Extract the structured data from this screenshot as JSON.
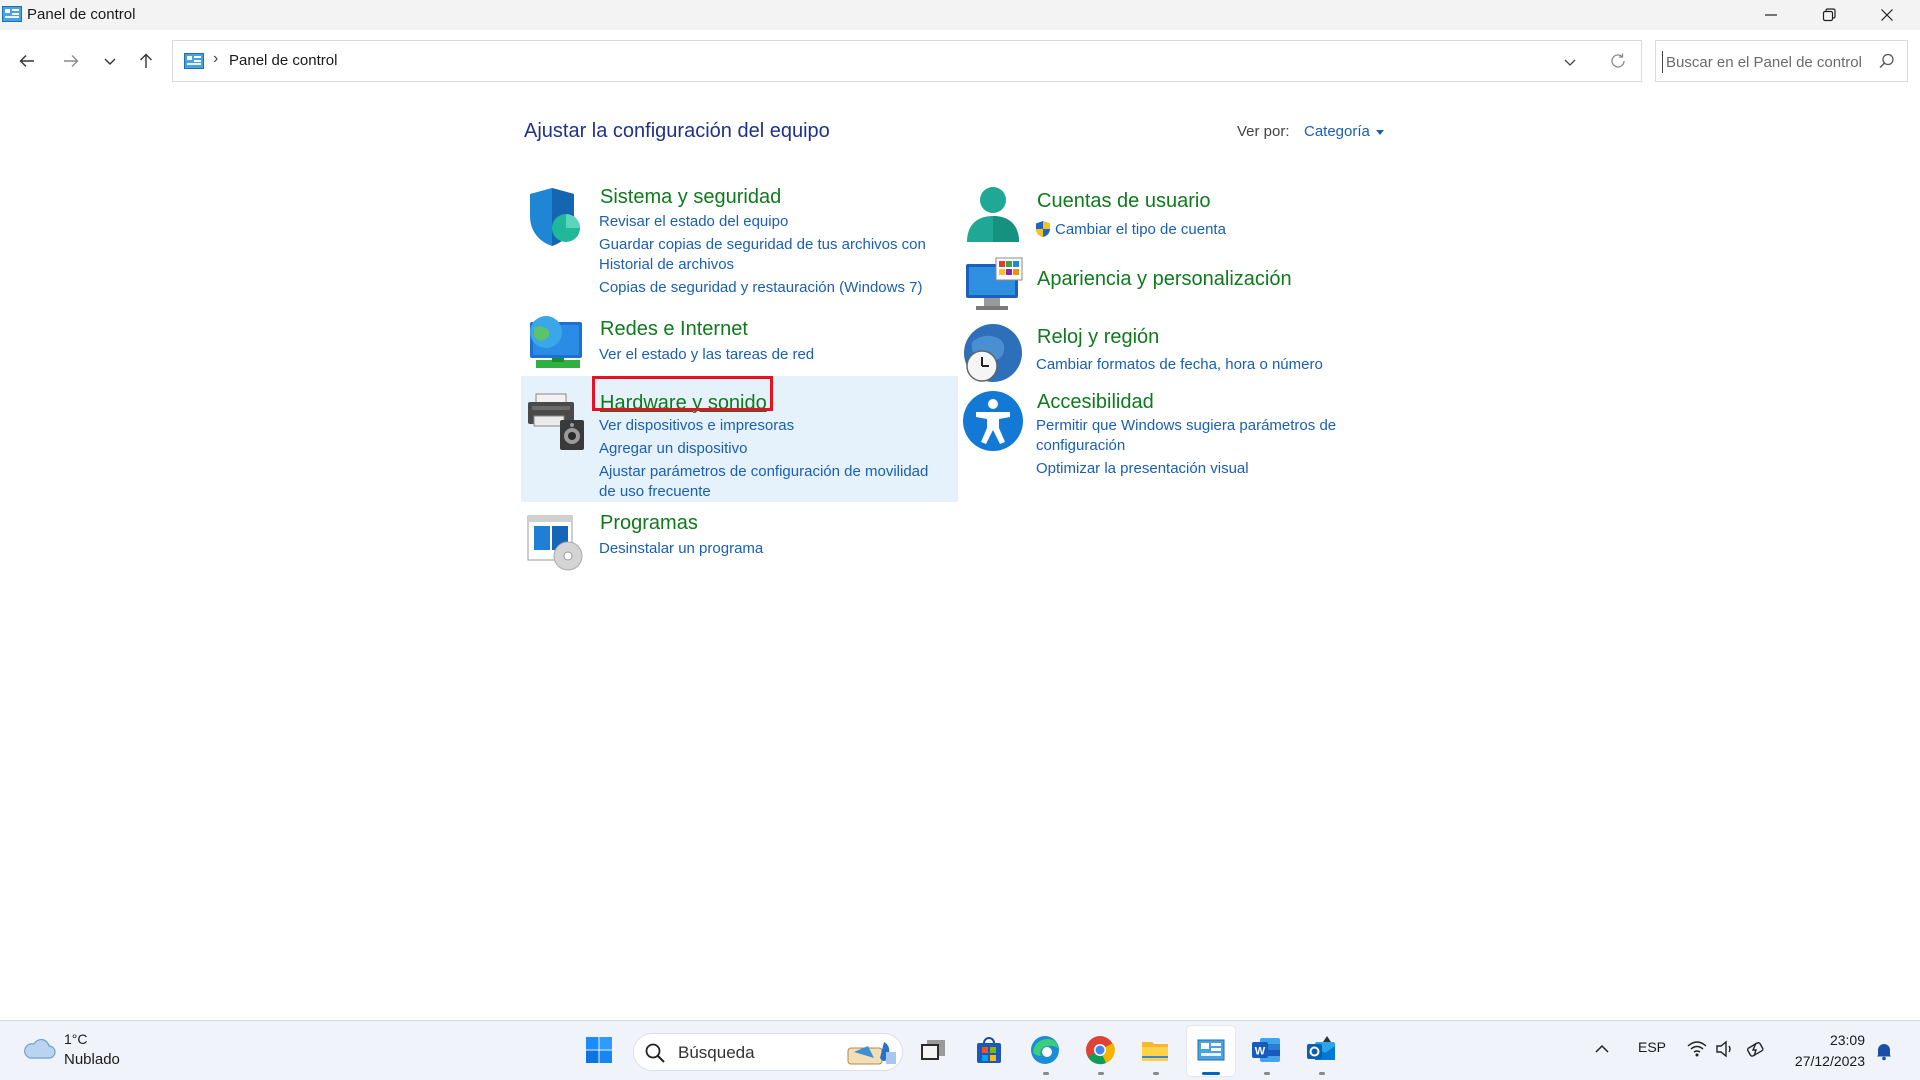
{
  "window": {
    "title": "Panel de control",
    "controls": {
      "minimize": "minimize-icon",
      "restore": "restore-icon",
      "close": "close-icon"
    }
  },
  "nav": {
    "back": "arrow-left-icon",
    "forward": "arrow-right-icon",
    "recent": "chevron-down-icon",
    "up": "arrow-up-icon"
  },
  "address": {
    "crumb": "Panel de control",
    "separator": "›"
  },
  "search": {
    "placeholder": "Buscar en el Panel de control"
  },
  "main": {
    "heading": "Ajustar la configuración del equipo",
    "view_by_label": "Ver por:",
    "view_by_value": "Categoría"
  },
  "categories": {
    "system": {
      "title": "Sistema y seguridad",
      "links": [
        "Revisar el estado del equipo",
        "Guardar copias de seguridad de tus archivos con",
        "Historial de archivos",
        "Copias de seguridad y restauración (Windows 7)"
      ]
    },
    "network": {
      "title": "Redes e Internet",
      "links": [
        "Ver el estado y las tareas de red"
      ]
    },
    "hardware": {
      "title": "Hardware y sonido",
      "links": [
        "Ver dispositivos e impresoras",
        "Agregar un dispositivo",
        "Ajustar parámetros de configuración de movilidad",
        "de uso frecuente"
      ]
    },
    "programs": {
      "title": "Programas",
      "links": [
        "Desinstalar un programa"
      ]
    },
    "users": {
      "title": "Cuentas de usuario",
      "links": [
        "Cambiar el tipo de cuenta"
      ]
    },
    "appearance": {
      "title": "Apariencia y personalización",
      "links": []
    },
    "clock": {
      "title": "Reloj y región",
      "links": [
        "Cambiar formatos de fecha, hora o número"
      ]
    },
    "access": {
      "title": "Accesibilidad",
      "links": [
        "Permitir que Windows sugiera parámetros de",
        "configuración",
        "Optimizar la presentación visual"
      ]
    }
  },
  "taskbar": {
    "weather_temp": "1°C",
    "weather_desc": "Nublado",
    "search_label": "Búsqueda",
    "apps": [
      "windows-start-icon",
      "task-view-icon",
      "microsoft-store-icon",
      "edge-icon",
      "chrome-icon",
      "file-explorer-icon",
      "control-panel-icon",
      "word-icon",
      "outlook-icon"
    ],
    "language": "ESP",
    "time": "23:09",
    "date": "27/12/2023"
  },
  "colors": {
    "category_title": "#0f7a1c",
    "link": "#1a5fb4",
    "heading": "#1e3287",
    "highlight_bg": "#e5f1fb",
    "annotation_box": "#e81123"
  }
}
